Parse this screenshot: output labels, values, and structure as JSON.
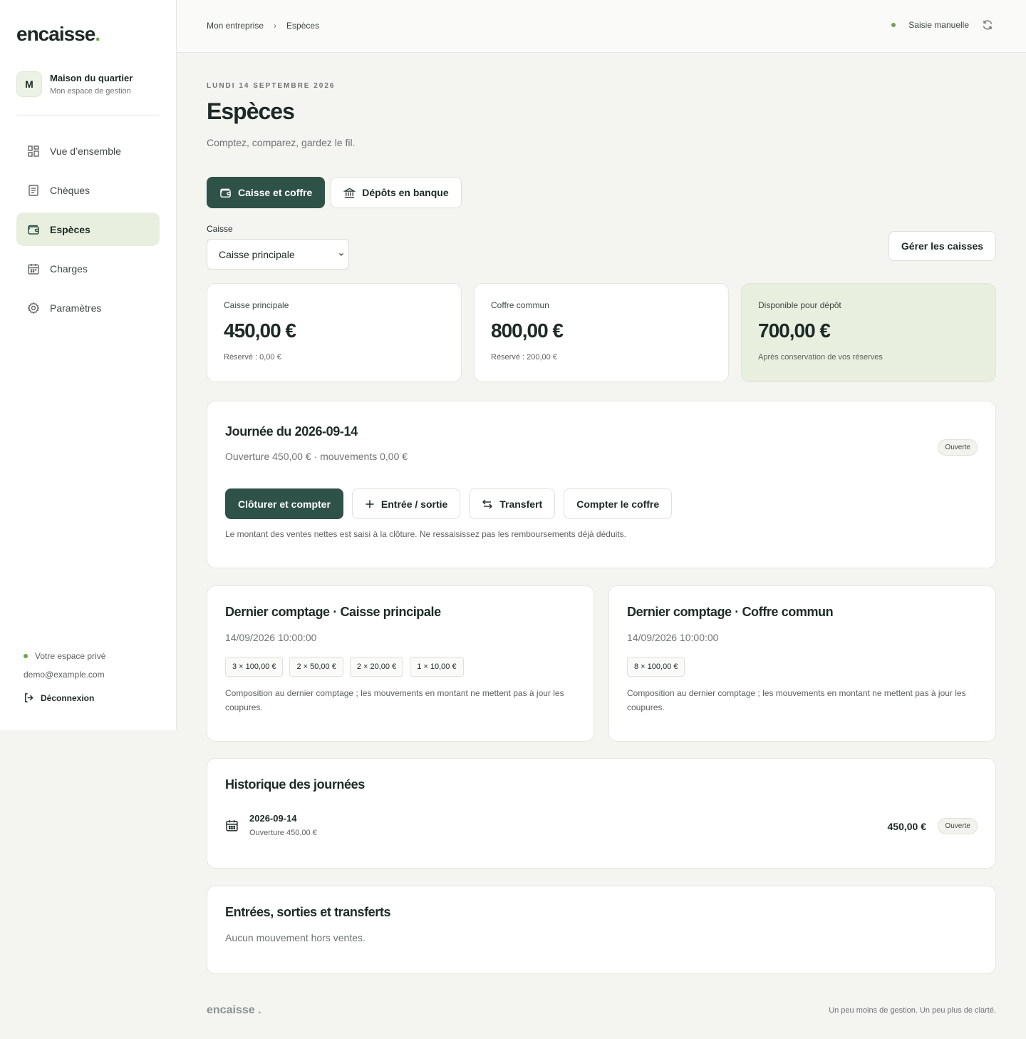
{
  "brand": {
    "name": "encaisse",
    "dot": ".",
    "accent": "#2f5248",
    "highlight": "#6aa552"
  },
  "org": {
    "initial": "M",
    "name": "Maison du quartier",
    "subtitle": "Mon espace de gestion"
  },
  "nav": {
    "items": [
      {
        "label": "Vue d’ensemble",
        "icon": "dashboard-icon"
      },
      {
        "label": "Chèques",
        "icon": "receipt-icon"
      },
      {
        "label": "Espèces",
        "icon": "wallet-icon",
        "active": true
      },
      {
        "label": "Charges",
        "icon": "calendar-icon"
      },
      {
        "label": "Paramètres",
        "icon": "gear-icon"
      }
    ]
  },
  "account": {
    "private_label": "Votre espace privé",
    "email": "demo@example.com",
    "logout_label": "Déconnexion"
  },
  "breadcrumb": {
    "items": [
      "Mon entreprise",
      "Espèces"
    ],
    "separator": "›"
  },
  "sync": {
    "label": "Saisie manuelle"
  },
  "page": {
    "date": "LUNDI 14 SEPTEMBRE 2026",
    "title": "Espèces",
    "subtitle": "Comptez, comparez, gardez le fil."
  },
  "tabs": [
    {
      "label": "Caisse et coffre",
      "icon": "wallet-icon",
      "active": true
    },
    {
      "label": "Dépôts en banque",
      "icon": "bank-icon"
    }
  ],
  "register_select": {
    "label": "Caisse",
    "value": "Caisse principale"
  },
  "manage_button": "Gérer les caisses",
  "stats": [
    {
      "label": "Caisse principale",
      "value": "450,00 €",
      "sub": "Réservé : 0,00 €"
    },
    {
      "label": "Coffre commun",
      "value": "800,00 €",
      "sub": "Réservé : 200,00 €"
    },
    {
      "label": "Disponible pour dépôt",
      "value": "700,00 €",
      "sub": "Après conservation de vos réserves"
    }
  ],
  "day": {
    "title": "Journée du 2026-09-14",
    "subtitle": "Ouverture 450,00 € · mouvements 0,00 €",
    "status": "Ouverte",
    "actions": {
      "close": "Clôturer et compter",
      "entry": "Entrée / sortie",
      "transfer": "Transfert",
      "count_safe": "Compter le coffre"
    },
    "note": "Le montant des ventes nettes est saisi à la clôture. Ne ressaisissez pas les remboursements déjà déduits."
  },
  "counts": [
    {
      "title": "Dernier comptage · Caisse principale",
      "datetime": "14/09/2026 10:00:00",
      "chips": [
        "3 × 100,00 €",
        "2 × 50,00 €",
        "2 × 20,00 €",
        "1 × 10,00 €"
      ],
      "note": "Composition au dernier comptage ; les mouvements en montant ne mettent pas à jour les coupures."
    },
    {
      "title": "Dernier comptage · Coffre commun",
      "datetime": "14/09/2026 10:00:00",
      "chips": [
        "8 × 100,00 €"
      ],
      "note": "Composition au dernier comptage ; les mouvements en montant ne mettent pas à jour les coupures."
    }
  ],
  "history": {
    "title": "Historique des journées",
    "rows": [
      {
        "date": "2026-09-14",
        "sub": "Ouverture 450,00 €",
        "amount": "450,00 €",
        "status": "Ouverte"
      }
    ]
  },
  "movements": {
    "title": "Entrées, sorties et transferts",
    "empty": "Aucun mouvement hors ventes."
  },
  "footer": {
    "brand": "encaisse",
    "dot": ".",
    "tagline": "Un peu moins de gestion. Un peu plus de clarté."
  }
}
